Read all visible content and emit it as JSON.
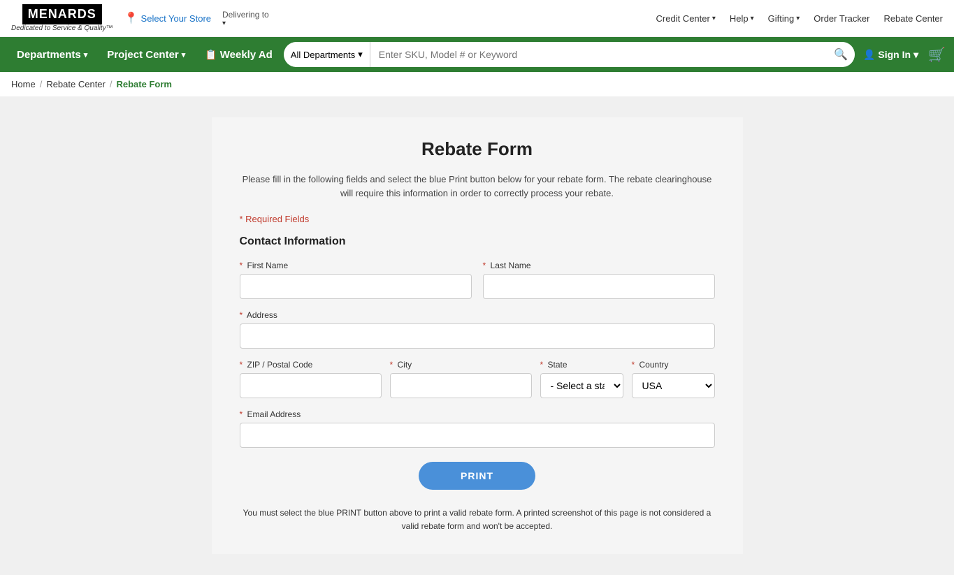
{
  "topbar": {
    "logo_main": "MENARDS",
    "logo_tagline": "Dedicated to Service & Quality™",
    "store_label": "Select Your Store",
    "delivering_label": "Delivering to",
    "nav_links": [
      {
        "label": "Credit Center",
        "has_chevron": true
      },
      {
        "label": "Help",
        "has_chevron": true
      },
      {
        "label": "Gifting",
        "has_chevron": true
      },
      {
        "label": "Order Tracker",
        "has_chevron": false
      },
      {
        "label": "Rebate Center",
        "has_chevron": false
      }
    ]
  },
  "navbar": {
    "departments_label": "Departments",
    "project_center_label": "Project Center",
    "weekly_ad_label": "Weekly Ad",
    "search_category": "All Departments",
    "search_placeholder": "Enter SKU, Model # or Keyword",
    "sign_in_label": "Sign In"
  },
  "breadcrumb": {
    "home": "Home",
    "rebate_center": "Rebate Center",
    "current": "Rebate Form"
  },
  "form": {
    "title": "Rebate Form",
    "description": "Please fill in the following fields and select the blue Print button below for your rebate form. The rebate clearinghouse will require this information in order to correctly process your rebate.",
    "required_note": "* Required Fields",
    "contact_title": "Contact Information",
    "first_name_label": "First Name",
    "last_name_label": "Last Name",
    "address_label": "Address",
    "zip_label": "ZIP / Postal Code",
    "city_label": "City",
    "state_label": "State",
    "state_default": "- Select a state -",
    "country_label": "Country",
    "country_default": "USA",
    "email_label": "Email Address",
    "print_btn_label": "PRINT",
    "print_note": "You must select the blue PRINT button above to print a valid rebate form. A printed screenshot of this page is not considered a valid rebate form and won't be accepted."
  }
}
